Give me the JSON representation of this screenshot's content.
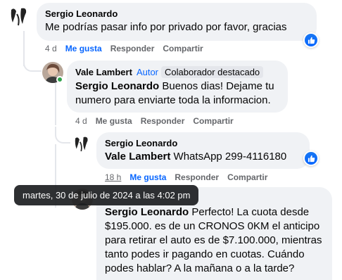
{
  "comments": [
    {
      "author": "Sergio Leonardo",
      "text": "Me podrías pasar info por privado por favor, gracias",
      "time": "4 d",
      "like": "Me gusta",
      "reply": "Responder",
      "share": "Compartir"
    },
    {
      "author": "Vale Lambert",
      "role": "Autor",
      "badge": "Colaborador destacado",
      "mention": "Sergio Leonardo",
      "text": " Buenos dias! Dejame tu numero para enviarte toda la informacion.",
      "time": "4 d",
      "like": "Me gusta",
      "reply": "Responder",
      "share": "Compartir"
    },
    {
      "author": "Sergio Leonardo",
      "mention": "Vale Lambert",
      "text": " WhatsApp 299-4116180",
      "time": "18 h",
      "like": "Me gusta",
      "reply": "Responder",
      "share": "Compartir"
    },
    {
      "mention": "Sergio Leonardo",
      "text": " Perfecto! La cuota desde $195.000. es de un CRONOS 0KM el anticipo para retirar el auto es de $7.100.000, mientras tanto podes ir pagando en cuotas. Cuándo podes hablar? A la mañana o a la tarde?"
    }
  ],
  "tooltip": "martes, 30 de julio de 2024 a las 4:02 pm",
  "colors": {
    "accent": "#0866ff",
    "bubble": "#f0f2f5"
  }
}
